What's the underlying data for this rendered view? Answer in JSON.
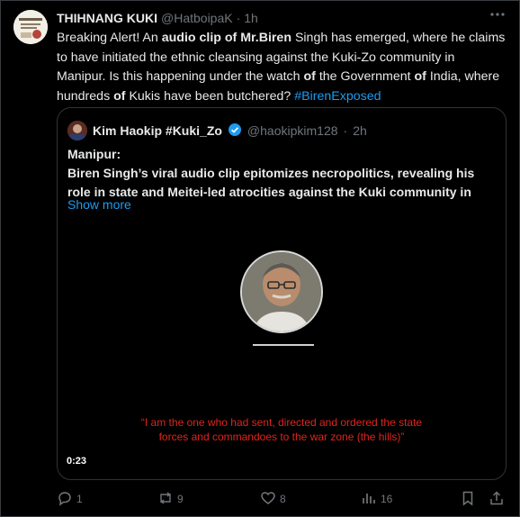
{
  "tweet": {
    "author_name": "THIHNANG KUKI",
    "handle": "@HatboipaK",
    "separator": "·",
    "time": "1h",
    "text_parts": {
      "p1": "Breaking Alert! An ",
      "b1": "audio clip of Mr.Biren",
      "p2": " Singh has emerged, where he claims to have initiated the ethnic cleansing against the Kuki-Zo community in Manipur. Is this happening under the watch ",
      "b2": "of",
      "p3": " the Government ",
      "b3": "of",
      "p4": " India, where hundreds ",
      "b4": "of",
      "p5": " Kukis have been butchered? ",
      "hashtag": "#BirenExposed"
    }
  },
  "quote": {
    "author_name": "Kim Haokip #Kuki_Zo",
    "handle": "@haokipkim128",
    "separator": "·",
    "time": "2h",
    "line1": "Manipur:",
    "line2": "Biren Singh’s viral audio clip epitomizes necropolitics, revealing his",
    "line3": "role in state and Meitei-led atrocities against the Kuki community in",
    "show_more": "Show more",
    "video": {
      "caption_line1": "“I am the one who had sent, directed and ordered the state",
      "caption_line2": "forces and commandoes to the war zone (the hills)”",
      "duration": "0:23"
    }
  },
  "actions": {
    "replies": "1",
    "reposts": "9",
    "likes": "8",
    "views": "16"
  },
  "colors": {
    "background": "#000000",
    "text": "#e7e9ea",
    "muted": "#71767b",
    "link": "#1d9bf0",
    "caption": "#e0241b",
    "verified": "#1d9bf0"
  }
}
